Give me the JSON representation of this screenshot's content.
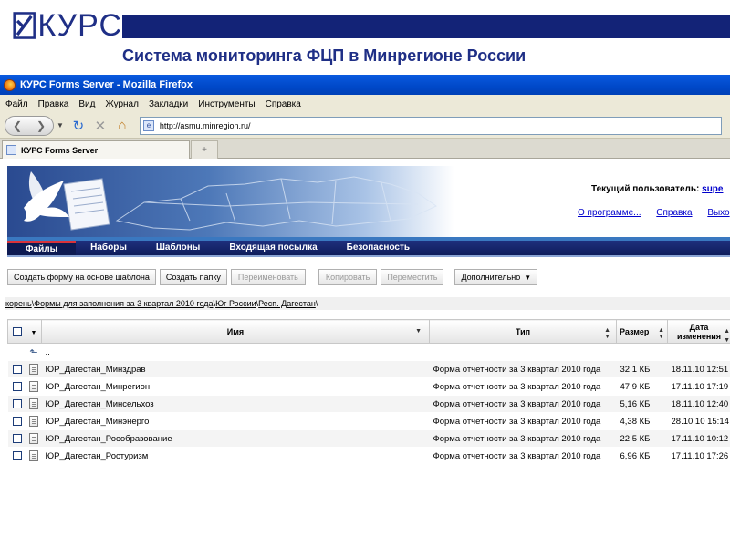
{
  "slide": {
    "logo_text": "КУРС",
    "title": "Система мониторинга ФЦП в Минрегионе России"
  },
  "browser": {
    "window_title": "КУРС Forms Server - Mozilla Firefox",
    "menu": [
      "Файл",
      "Правка",
      "Вид",
      "Журнал",
      "Закладки",
      "Инструменты",
      "Справка"
    ],
    "url": "http://asmu.minregion.ru/",
    "tab_title": "КУРС Forms Server",
    "new_tab_symbol": "+"
  },
  "page": {
    "user_label": "Текущий пользователь:",
    "user_name": "supe",
    "links": [
      "О программе...",
      "Справка",
      "Выхо"
    ],
    "nav": [
      "Файлы",
      "Наборы",
      "Шаблоны",
      "Входящая посылка",
      "Безопасность"
    ],
    "nav_active": "Файлы",
    "actions": {
      "create_from_template": "Создать форму на основе шаблона",
      "create_folder": "Создать папку",
      "rename": "Переименовать",
      "copy": "Копировать",
      "move": "Переместить",
      "more": "Дополнительно"
    },
    "breadcrumb": [
      "корень",
      "Формы для заполнения за 3 квартал 2010 года",
      "Юг России",
      "Респ. Дагестан"
    ],
    "breadcrumb_sep": "\\",
    "table": {
      "columns": {
        "name": "Имя",
        "type": "Тип",
        "size": "Размер",
        "modified": "Дата изменения"
      },
      "up_label": "..",
      "rows": [
        {
          "name": "ЮР_Дагестан_Минздрав",
          "type": "Форма отчетности за 3 квартал 2010 года",
          "size": "32,1 КБ",
          "modified": "18.11.10 12:51"
        },
        {
          "name": "ЮР_Дагестан_Минрегион",
          "type": "Форма отчетности за 3 квартал 2010 года",
          "size": "47,9 КБ",
          "modified": "17.11.10 17:19"
        },
        {
          "name": "ЮР_Дагестан_Минсельхоз",
          "type": "Форма отчетности за 3 квартал 2010 года",
          "size": "5,16 КБ",
          "modified": "18.11.10 12:40"
        },
        {
          "name": "ЮР_Дагестан_Минэнерго",
          "type": "Форма отчетности за 3 квартал 2010 года",
          "size": "4,38 КБ",
          "modified": "28.10.10 15:14"
        },
        {
          "name": "ЮР_Дагестан_Рособразование",
          "type": "Форма отчетности за 3 квартал 2010 года",
          "size": "22,5 КБ",
          "modified": "17.11.10 10:12"
        },
        {
          "name": "ЮР_Дагестан_Ростуризм",
          "type": "Форма отчетности за 3 квартал 2010 года",
          "size": "6,96 КБ",
          "modified": "17.11.10 17:26"
        }
      ]
    }
  },
  "colors": {
    "brand_navy": "#132377",
    "title_blue": "#1f2f86",
    "xp_titlebar": "#0048c8",
    "nav_active_marker": "#d8323a",
    "link_blue": "#0000cc"
  },
  "icons": [
    "kurs-logo-icon",
    "firefox-icon",
    "back-icon",
    "forward-icon",
    "reload-icon",
    "stop-icon",
    "home-icon",
    "page-favicon-icon",
    "dove-icon",
    "document-icon",
    "russia-map-icon",
    "folder-up-icon",
    "file-icon",
    "sort-icon",
    "dropdown-caret-icon"
  ]
}
